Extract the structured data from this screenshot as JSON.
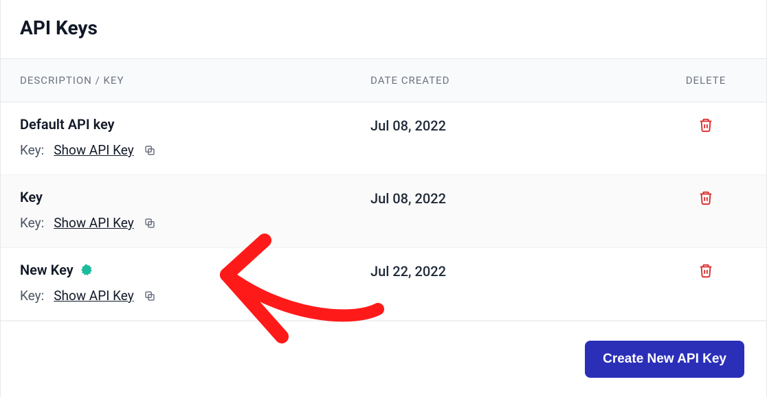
{
  "page_title": "API Keys",
  "columns": {
    "description": "DESCRIPTION / KEY",
    "date": "DATE CREATED",
    "delete": "DELETE"
  },
  "key_prefix": "Key:",
  "show_label": "Show API Key",
  "rows": [
    {
      "title": "Default API key",
      "date": "Jul 08, 2022",
      "is_new": false
    },
    {
      "title": "Key",
      "date": "Jul 08, 2022",
      "is_new": false
    },
    {
      "title": "New Key",
      "date": "Jul 22, 2022",
      "is_new": true
    }
  ],
  "create_button": "Create New API Key",
  "colors": {
    "accent": "#2b2fb8",
    "danger": "#dc2626",
    "badge": "#1abc9c",
    "annotation": "#ff1a1a"
  }
}
